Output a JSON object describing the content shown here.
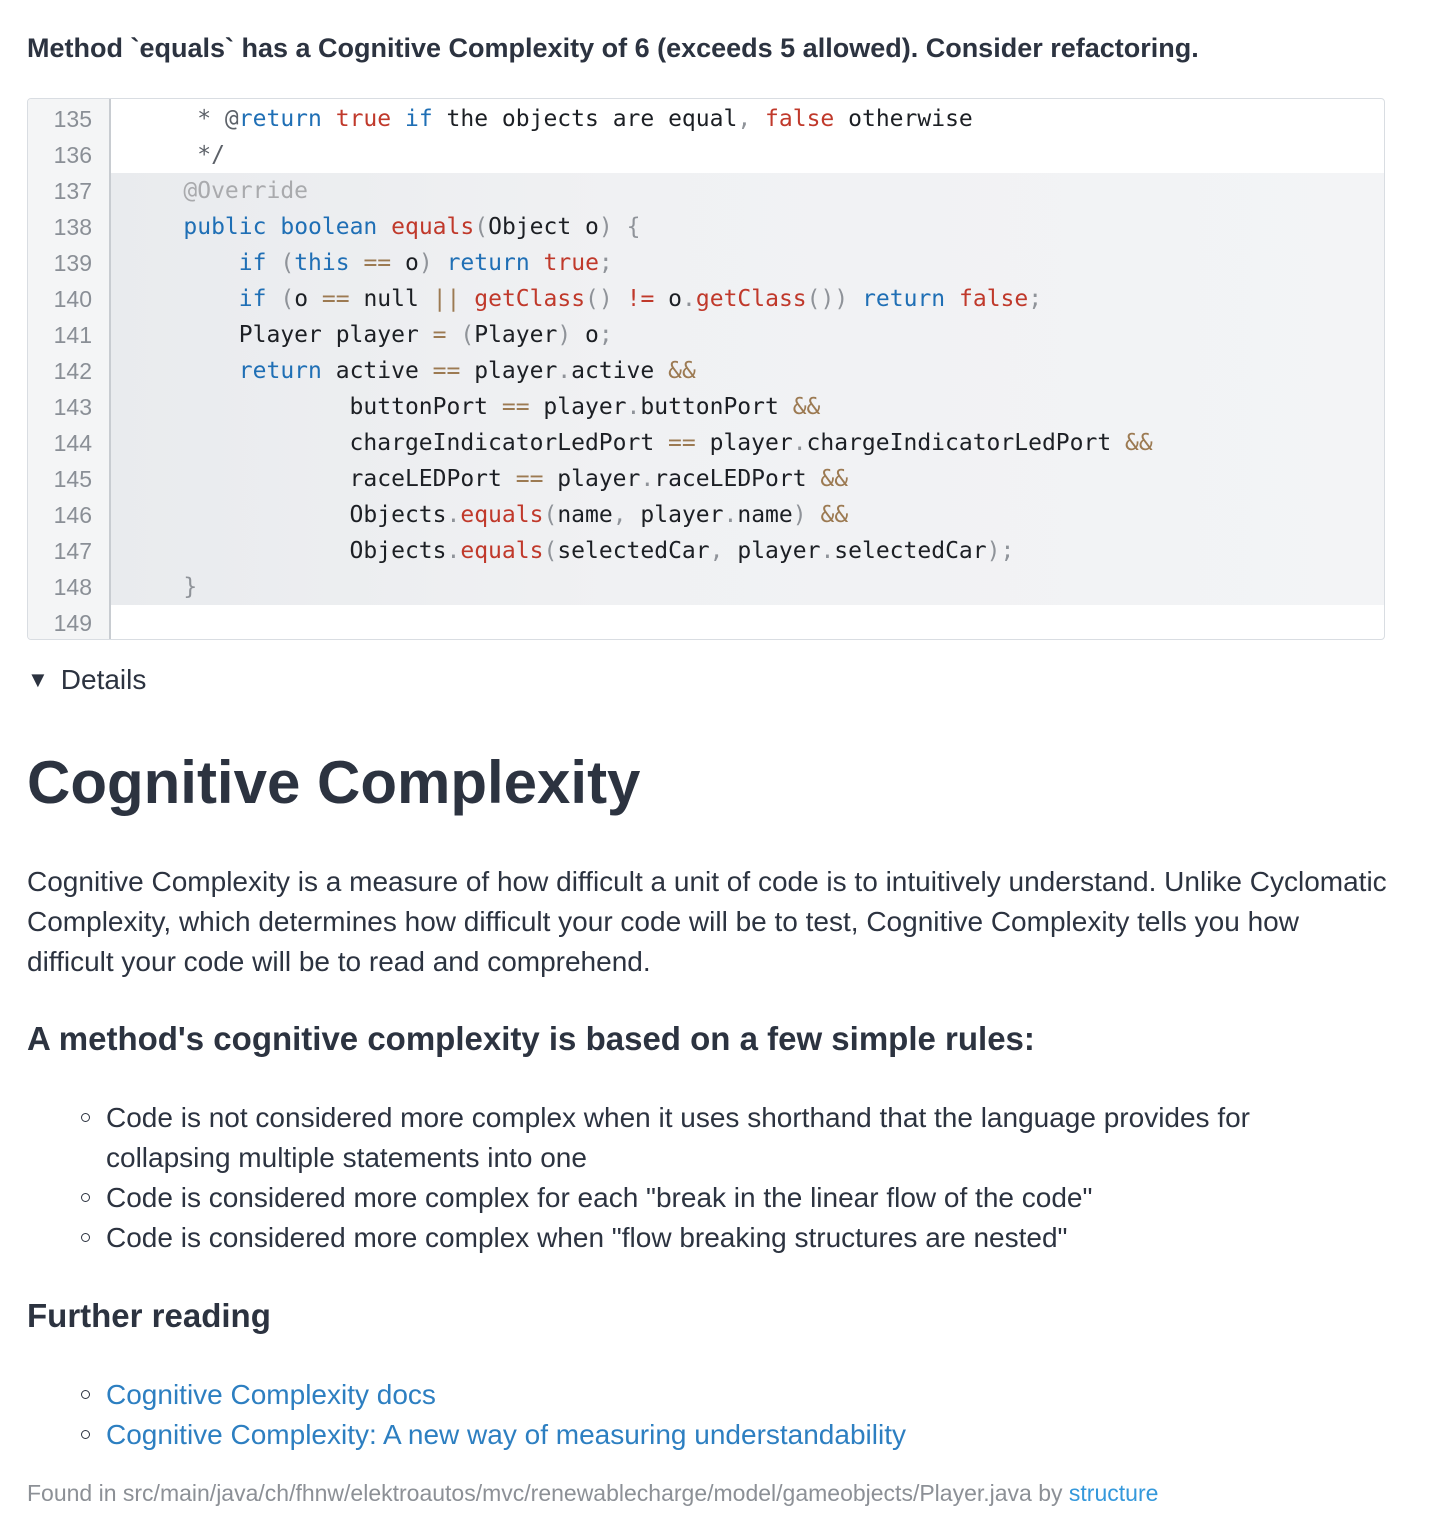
{
  "issue": {
    "title": "Method `equals` has a Cognitive Complexity of 6 (exceeds 5 allowed). Consider refactoring."
  },
  "code": {
    "lines": [
      {
        "num": "135",
        "tokens": [
          [
            "     * @",
            "t-cm"
          ],
          [
            "return",
            "t-kw"
          ],
          [
            " ",
            ""
          ],
          [
            "true",
            "t-lit"
          ],
          [
            " ",
            ""
          ],
          [
            "if",
            "t-kw"
          ],
          [
            " the objects are equal",
            ""
          ],
          [
            ",",
            "t-gray"
          ],
          [
            " ",
            ""
          ],
          [
            "false",
            "t-lit"
          ],
          [
            " otherwise",
            ""
          ]
        ]
      },
      {
        "num": "136",
        "tokens": [
          [
            "     */",
            "t-cm"
          ]
        ]
      },
      {
        "num": "137",
        "tokens": [
          [
            "    @Override",
            "t-an"
          ]
        ]
      },
      {
        "num": "138",
        "tokens": [
          [
            "    ",
            ""
          ],
          [
            "public",
            "t-kw"
          ],
          [
            " ",
            ""
          ],
          [
            "boolean",
            "t-kw"
          ],
          [
            " ",
            ""
          ],
          [
            "equals",
            "t-fn"
          ],
          [
            "(",
            "t-gray"
          ],
          [
            "Object o",
            ""
          ],
          [
            ")",
            "t-gray"
          ],
          [
            " ",
            ""
          ],
          [
            "{",
            "t-gray"
          ]
        ]
      },
      {
        "num": "139",
        "tokens": [
          [
            "        ",
            ""
          ],
          [
            "if",
            "t-kw"
          ],
          [
            " ",
            ""
          ],
          [
            "(",
            "t-gray"
          ],
          [
            "this",
            "t-kw"
          ],
          [
            " ",
            ""
          ],
          [
            "==",
            "t-op"
          ],
          [
            " o",
            ""
          ],
          [
            ")",
            "t-gray"
          ],
          [
            " ",
            ""
          ],
          [
            "return",
            "t-kw"
          ],
          [
            " ",
            ""
          ],
          [
            "true",
            "t-lit"
          ],
          [
            ";",
            "t-gray"
          ]
        ]
      },
      {
        "num": "140",
        "tokens": [
          [
            "        ",
            ""
          ],
          [
            "if",
            "t-kw"
          ],
          [
            " ",
            ""
          ],
          [
            "(",
            "t-gray"
          ],
          [
            "o ",
            ""
          ],
          [
            "==",
            "t-op"
          ],
          [
            " null ",
            ""
          ],
          [
            "||",
            "t-op"
          ],
          [
            " ",
            ""
          ],
          [
            "getClass",
            "t-fn"
          ],
          [
            "()",
            "t-gray"
          ],
          [
            " ",
            ""
          ],
          [
            "!=",
            "t-lit"
          ],
          [
            " o",
            ""
          ],
          [
            ".",
            "t-gray"
          ],
          [
            "getClass",
            "t-fn"
          ],
          [
            "())",
            "t-gray"
          ],
          [
            " ",
            ""
          ],
          [
            "return",
            "t-kw"
          ],
          [
            " ",
            ""
          ],
          [
            "false",
            "t-lit"
          ],
          [
            ";",
            "t-gray"
          ]
        ]
      },
      {
        "num": "141",
        "tokens": [
          [
            "        Player player ",
            ""
          ],
          [
            "=",
            "t-op"
          ],
          [
            " ",
            ""
          ],
          [
            "(",
            "t-gray"
          ],
          [
            "Player",
            ""
          ],
          [
            ")",
            "t-gray"
          ],
          [
            " o",
            ""
          ],
          [
            ";",
            "t-gray"
          ]
        ]
      },
      {
        "num": "142",
        "tokens": [
          [
            "        ",
            ""
          ],
          [
            "return",
            "t-kw"
          ],
          [
            " active ",
            ""
          ],
          [
            "==",
            "t-op"
          ],
          [
            " player",
            ""
          ],
          [
            ".",
            "t-gray"
          ],
          [
            "active ",
            ""
          ],
          [
            "&&",
            "t-op"
          ]
        ]
      },
      {
        "num": "143",
        "tokens": [
          [
            "                buttonPort ",
            ""
          ],
          [
            "==",
            "t-op"
          ],
          [
            " player",
            ""
          ],
          [
            ".",
            "t-gray"
          ],
          [
            "buttonPort ",
            ""
          ],
          [
            "&&",
            "t-op"
          ]
        ]
      },
      {
        "num": "144",
        "tokens": [
          [
            "                chargeIndicatorLedPort ",
            ""
          ],
          [
            "==",
            "t-op"
          ],
          [
            " player",
            ""
          ],
          [
            ".",
            "t-gray"
          ],
          [
            "chargeIndicatorLedPort ",
            ""
          ],
          [
            "&&",
            "t-op"
          ]
        ]
      },
      {
        "num": "145",
        "tokens": [
          [
            "                raceLEDPort ",
            ""
          ],
          [
            "==",
            "t-op"
          ],
          [
            " player",
            ""
          ],
          [
            ".",
            "t-gray"
          ],
          [
            "raceLEDPort ",
            ""
          ],
          [
            "&&",
            "t-op"
          ]
        ]
      },
      {
        "num": "146",
        "tokens": [
          [
            "                Objects",
            ""
          ],
          [
            ".",
            "t-gray"
          ],
          [
            "equals",
            "t-fn"
          ],
          [
            "(",
            "t-gray"
          ],
          [
            "name",
            ""
          ],
          [
            ",",
            "t-gray"
          ],
          [
            " player",
            ""
          ],
          [
            ".",
            "t-gray"
          ],
          [
            "name",
            ""
          ],
          [
            ")",
            "t-gray"
          ],
          [
            " ",
            ""
          ],
          [
            "&&",
            "t-op"
          ]
        ]
      },
      {
        "num": "147",
        "tokens": [
          [
            "                Objects",
            ""
          ],
          [
            ".",
            "t-gray"
          ],
          [
            "equals",
            "t-fn"
          ],
          [
            "(",
            "t-gray"
          ],
          [
            "selectedCar",
            ""
          ],
          [
            ",",
            "t-gray"
          ],
          [
            " player",
            ""
          ],
          [
            ".",
            "t-gray"
          ],
          [
            "selectedCar",
            ""
          ],
          [
            ");",
            "t-gray"
          ]
        ]
      },
      {
        "num": "148",
        "tokens": [
          [
            "    ",
            ""
          ],
          [
            "}",
            "t-gray"
          ]
        ]
      },
      {
        "num": "149",
        "tokens": []
      }
    ],
    "highlighted": [
      "137",
      "138",
      "139",
      "140",
      "141",
      "142",
      "143",
      "144",
      "145",
      "146",
      "147",
      "148"
    ]
  },
  "details": {
    "toggle_icon": "▼",
    "label": "Details"
  },
  "doc": {
    "heading": "Cognitive Complexity",
    "intro": "Cognitive Complexity is a measure of how difficult a unit of code is to intuitively understand. Unlike Cyclomatic Complexity, which determines how difficult your code will be to test, Cognitive Complexity tells you how difficult your code will be to read and comprehend.",
    "rules_heading": "A method's cognitive complexity is based on a few simple rules:",
    "rules": [
      "Code is not considered more complex when it uses shorthand that the language provides for collapsing multiple statements into one",
      "Code is considered more complex for each \"break in the linear flow of the code\"",
      "Code is considered more complex when \"flow breaking structures are nested\""
    ],
    "further_heading": "Further reading",
    "links": [
      "Cognitive Complexity docs",
      "Cognitive Complexity: A new way of measuring understandability"
    ]
  },
  "footer": {
    "prefix": "Found in src/main/java/ch/fhnw/elektroautos/mvc/renewablecharge/model/gameobjects/Player.java by",
    "engine_link": "structure"
  },
  "colors": {
    "keyword": "#1f6fb5",
    "literal": "#c0392b",
    "operator": "#9c7a52",
    "link": "#2d7fc1"
  }
}
